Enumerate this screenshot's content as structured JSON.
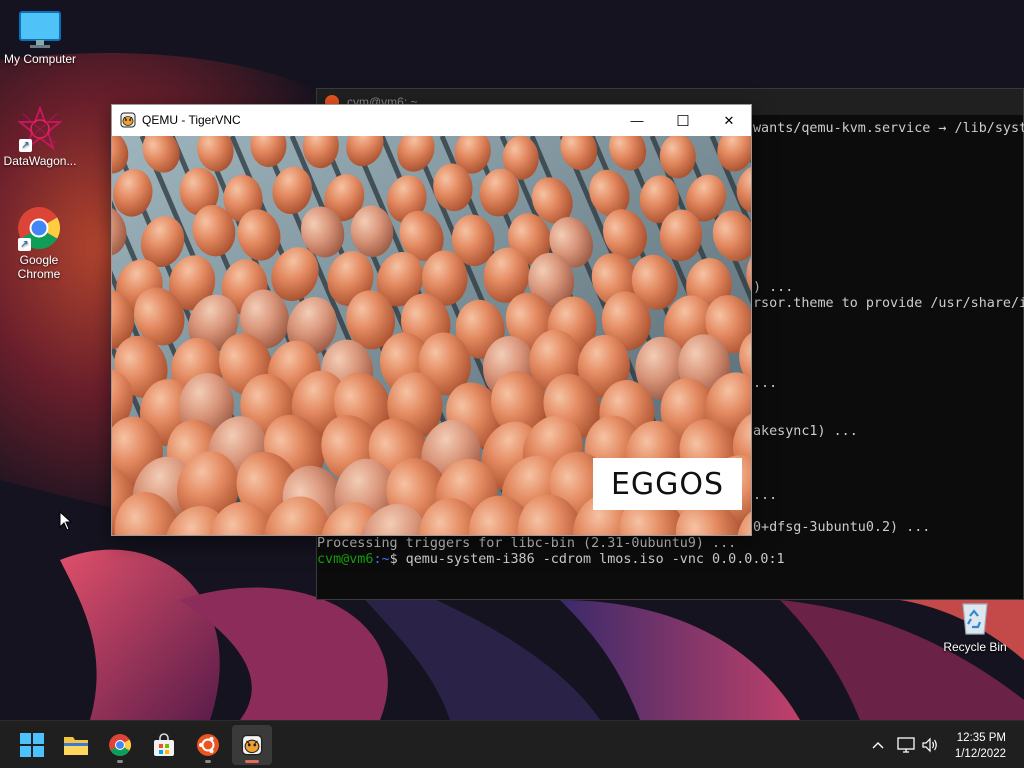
{
  "desktop": {
    "icons": [
      {
        "label": "My Computer",
        "icon": "monitor-icon"
      },
      {
        "label": "DataWagon...",
        "icon": "datawagon-icon"
      },
      {
        "label": "Google Chrome",
        "icon": "chrome-icon"
      }
    ],
    "recycle_bin": {
      "label": "Recycle Bin",
      "icon": "recycle-bin-icon"
    }
  },
  "terminal": {
    "tab_title": "cvm@vm6: ~",
    "lines": [
      "wants/qemu-kvm.service → /lib/syste",
      ") ...",
      "rsor.theme to provide /usr/share/ic",
      "...",
      "akesync1) ...",
      "...",
      "0+dfsg-3ubuntu0.2) ...",
      "Processing triggers for libc-bin (2.31-0ubuntu9) ..."
    ],
    "prompt_user": "cvm@vm6",
    "prompt_path": ":~",
    "prompt_symbol": "$",
    "command": " qemu-system-i386 -cdrom lmos.iso -vnc 0.0.0.0:1"
  },
  "vnc_window": {
    "title": "QEMU - TigerVNC",
    "minimize": "—",
    "maximize": "☐",
    "close": "✕",
    "screen_caption": "EGGOS"
  },
  "taskbar": {
    "apps": [
      {
        "name": "start",
        "icon": "windows-start-icon"
      },
      {
        "name": "file-explorer",
        "icon": "folder-icon"
      },
      {
        "name": "chrome",
        "icon": "chrome-icon"
      },
      {
        "name": "store",
        "icon": "store-icon"
      },
      {
        "name": "ubuntu",
        "icon": "ubuntu-icon"
      },
      {
        "name": "tigervnc",
        "icon": "tigervnc-icon"
      }
    ],
    "clock_time": "12:35 PM",
    "clock_date": "1/12/2022"
  },
  "colors": {
    "terminal_bg": "#0c0c0c",
    "prompt_green": "#13a10e",
    "prompt_blue": "#3b78ff",
    "taskbar_bg": "#1f1f1f",
    "ubuntu_orange": "#e95420"
  }
}
